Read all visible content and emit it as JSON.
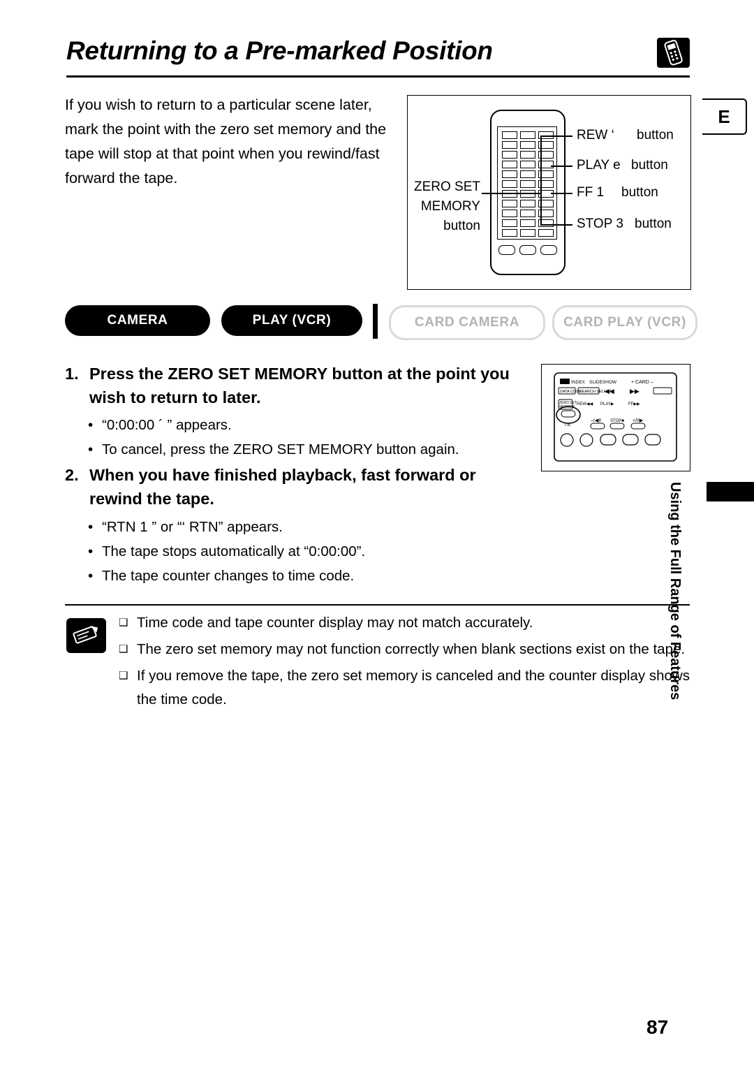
{
  "title": "Returning to a Pre-marked Position",
  "title_icon": "remote-control-icon",
  "language_tab": "E",
  "intro": "If you wish to return to a particular scene later, mark the point with the zero set memory and the tape will stop at that point when you rewind/fast forward the tape.",
  "remote_labels": {
    "zero_set": "ZERO SET",
    "memory": "MEMORY",
    "button_left": "button",
    "rew": "REW ‘",
    "rew_button": "button",
    "play": "PLAY e",
    "play_button": "button",
    "ff": "FF 1",
    "ff_button": "button",
    "stop": "STOP 3",
    "stop_button": "button"
  },
  "chips": [
    {
      "label": "CAMERA",
      "state": "on"
    },
    {
      "label": "PLAY (VCR)",
      "state": "on"
    },
    {
      "label": "CARD CAMERA",
      "state": "off"
    },
    {
      "label": "CARD PLAY (VCR)",
      "state": "off"
    }
  ],
  "steps": [
    {
      "number": "1.",
      "heading": "Press the ZERO SET MEMORY button at the point you wish to return to later.",
      "bullets": [
        "“0:00:00 ´ ” appears.",
        "To cancel, press the ZERO SET MEMORY button again."
      ]
    },
    {
      "number": "2.",
      "heading": "When you have finished playback, fast forward or rewind the tape.",
      "bullets": [
        "“RTN 1    ” or “‘    RTN” appears.",
        "The tape stops automatically at “0:00:00”.",
        "The tape counter changes to time code."
      ]
    }
  ],
  "camera_panel": {
    "index": "INDEX",
    "slideshow": "SLIDESHOW",
    "card_plus": "+ CARD –",
    "data_code": "DATA CODE",
    "search_select": "SEARCH SELECT",
    "zero_set": "ZERO SET",
    "memory": "MEMORY",
    "rew": "REW",
    "play": "PLAY",
    "ff": "FF",
    "stop": "STOP",
    "tv": "TV",
    "slow_minus": "–/◀II",
    "slow_plus": "+/II▶"
  },
  "notes_icon": "pencil-note-icon",
  "notes": [
    "Time code and tape counter display may not match accurately.",
    "The zero set memory may not function correctly when blank sections exist on the tape.",
    "If you remove the tape, the zero set memory is canceled and the counter display shows the time code."
  ],
  "side_tab_text": "Using the Full Range of Features",
  "page_number": "87"
}
